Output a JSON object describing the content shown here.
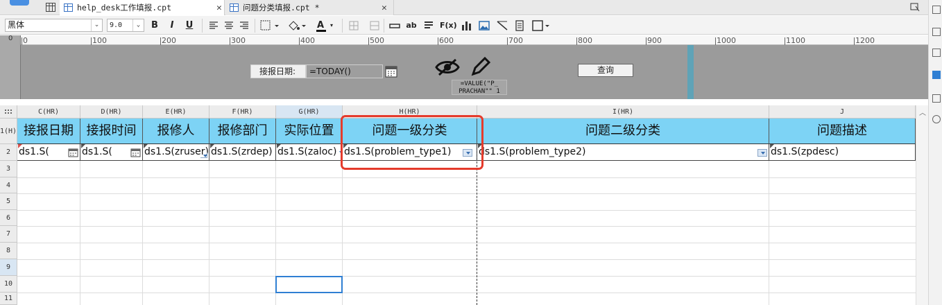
{
  "tabs": [
    {
      "label": "help_desk工作填报.cpt",
      "close": "✕"
    },
    {
      "label": "问题分类填报.cpt *",
      "close": "✕"
    }
  ],
  "toolbar": {
    "font": "黑体",
    "size": "9.0",
    "bold": "B",
    "italic": "I",
    "underline": "U",
    "text_color_letter": "A",
    "ab_label": "ab",
    "fx_label": "F(x)"
  },
  "ruler": {
    "ticks": [
      "0",
      "100",
      "200",
      "300",
      "400",
      "500",
      "600",
      "700",
      "800",
      "900",
      "1000",
      "1100",
      "1200"
    ],
    "side": "0"
  },
  "params": {
    "label": "接报日期:",
    "value": "=TODAY()",
    "formula": "=VALUE(\"P_\nPRACHAN\"\" 1",
    "query_button": "查询"
  },
  "columns": [
    "C(HR)",
    "D(HR)",
    "E(HR)",
    "F(HR)",
    "G(HR)",
    "H(HR)",
    "I(HR)",
    "J"
  ],
  "rows": [
    "1(H)",
    "2",
    "3",
    "4",
    "5",
    "6",
    "7",
    "8",
    "9",
    "10",
    "11"
  ],
  "headers": [
    "接报日期",
    "接报时间",
    "报修人",
    "报修部门",
    "实际位置",
    "问题一级分类",
    "问题二级分类",
    "问题描述"
  ],
  "cells": [
    "ds1.S(",
    "ds1.S(",
    "ds1.S(zruser)",
    "ds1.S(zrdep)",
    "ds1.S(zaloc)",
    "ds1.S(problem_type1)",
    "ds1.S(problem_type2)",
    "ds1.S(zpdesc)"
  ],
  "colors": {
    "header_bg": "#7dd3f5",
    "highlight": "#e53b2c",
    "selection": "#2f7fd3",
    "param_pane": "#9b9b9b"
  }
}
